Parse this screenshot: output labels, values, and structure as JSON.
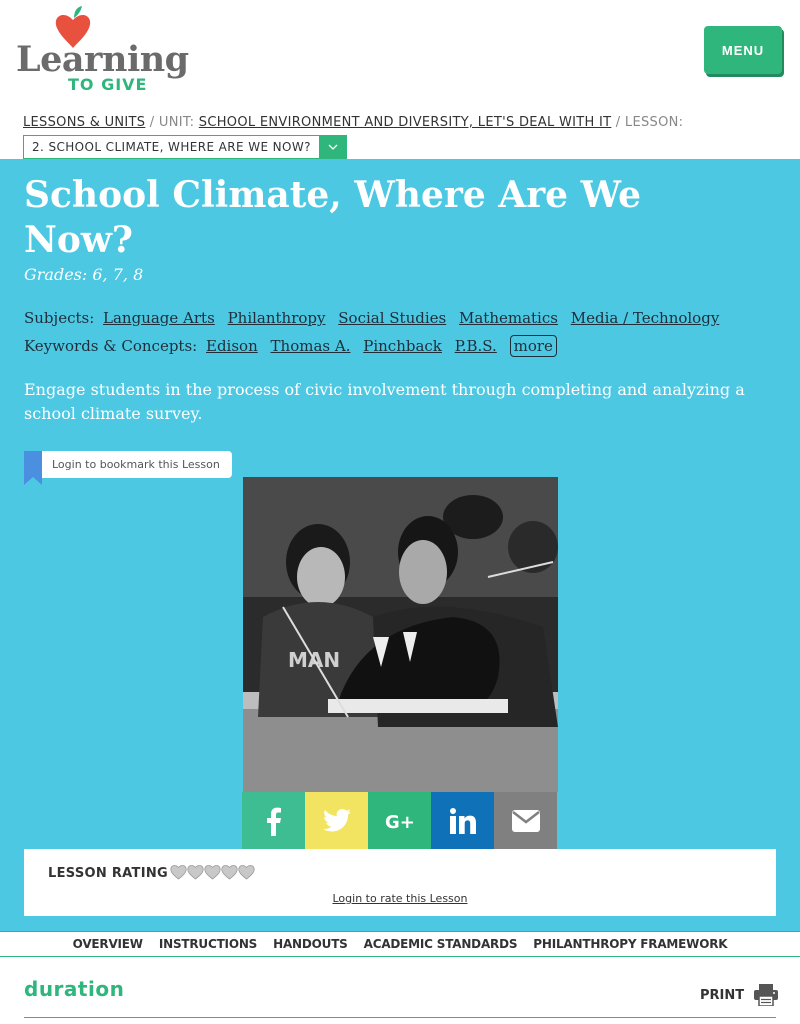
{
  "logo": {
    "word1": "Learning",
    "word2": "TO GIVE"
  },
  "header": {
    "menu_label": "MENU"
  },
  "breadcrumb": {
    "root": "LESSONS & UNITS",
    "sep1": " / UNIT: ",
    "unit": "SCHOOL ENVIRONMENT AND DIVERSITY, LET'S DEAL WITH IT",
    "sep2": " / LESSON:",
    "lesson_selected": "2. SCHOOL CLIMATE, WHERE ARE WE NOW?"
  },
  "lesson": {
    "title": "School Climate, Where Are We Now?",
    "grades": "Grades: 6, 7, 8",
    "subjects_label": "Subjects:",
    "subjects": [
      "Language Arts",
      "Philanthropy",
      "Social Studies",
      "Mathematics",
      "Media / Technology"
    ],
    "keywords_label": "Keywords & Concepts:",
    "keywords": [
      "Edison",
      "Thomas A.",
      "Pinchback",
      "P.B.S."
    ],
    "more_label": "more",
    "description": "Engage students in the process of civic involvement through completing and analyzing a school climate survey.",
    "bookmark_label": "Login to bookmark this Lesson"
  },
  "share": [
    "facebook-icon",
    "twitter-icon",
    "google-plus-icon",
    "linkedin-icon",
    "email-icon"
  ],
  "rating": {
    "label": "LESSON RATING",
    "hearts_filled": 0,
    "hearts_total": 5,
    "login_label": "Login to rate this Lesson"
  },
  "tabs": [
    "OVERVIEW",
    "INSTRUCTIONS",
    "HANDOUTS",
    "ACADEMIC STANDARDS",
    "PHILANTHROPY FRAMEWORK"
  ],
  "section": {
    "heading": "duration",
    "print_label": "PRINT"
  },
  "colors": {
    "brand_green": "#2fb67c",
    "hero_blue": "#4cc8e3",
    "apple_red": "#e8513d",
    "bookmark_blue": "#4a8fe0"
  }
}
